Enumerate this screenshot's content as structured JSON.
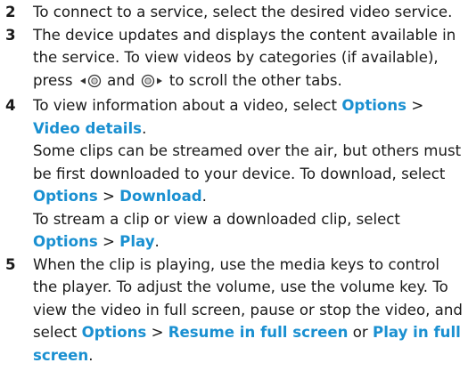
{
  "accent": "#1a90d1",
  "steps": [
    {
      "num": "2",
      "t1": "To connect to a service, select the desired video service."
    },
    {
      "num": "3",
      "t1": "The device updates and displays the content available in the service. To view videos by categories (if available), press",
      "icon_left": "scroll-left-key-icon",
      "t2": "and",
      "icon_right": "scroll-right-key-icon",
      "t3": "to scroll the other tabs."
    },
    {
      "num": "4",
      "p1": {
        "t1": "To view information about a video, select",
        "k1": "Options",
        "sep": ">",
        "k2": "Video details",
        "t2": "."
      },
      "p2": {
        "t1": "Some clips can be streamed over the air, but others must be first downloaded to your device. To download, select",
        "k1": "Options",
        "sep": ">",
        "k2": "Download",
        "t2": "."
      },
      "p3": {
        "t1": "To stream a clip or view a downloaded clip, select",
        "k1": "Options",
        "sep": ">",
        "k2": "Play",
        "t2": "."
      }
    },
    {
      "num": "5",
      "t1": "When the clip is playing, use the media keys to control the player. To adjust the volume, use the volume key. To view the video in full screen, pause or stop the video, and select",
      "k1": "Options",
      "sep": ">",
      "k2": "Resume in full screen",
      "or": "or",
      "k3": "Play in full screen",
      "t2": "."
    }
  ]
}
